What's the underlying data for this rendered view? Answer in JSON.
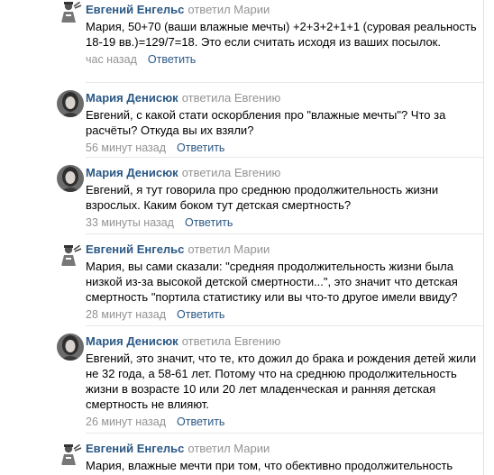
{
  "comments": [
    {
      "author": "Евгений Енгельс",
      "action": "ответил",
      "target": "Марии",
      "avatar": "doctor-icon",
      "text": "Мария, 50+70 (ваши влажные мечты) +2+3+2+1+1 (суровая реальность 18-19 вв.)=129/7=18. Это если считать исходя из ваших посылок.",
      "time": "час назад",
      "reply": "Ответить"
    },
    {
      "author": "Мария Денисюк",
      "action": "ответила",
      "target": "Евгению",
      "avatar": "user-photo-icon",
      "text": "Евгений, с какой стати оскорбления про \"влажные мечты\"? Что за расчёты? Откуда вы их взяли?",
      "time": "56 минут назад",
      "reply": "Ответить"
    },
    {
      "author": "Мария Денисюк",
      "action": "ответила",
      "target": "Евгению",
      "avatar": "user-photo-icon",
      "text": "Евгений, я тут говорила про среднюю продолжительность жизни взрослых. Каким боком тут детская смертность?",
      "time": "33 минуты назад",
      "reply": "Ответить"
    },
    {
      "author": "Евгений Енгельс",
      "action": "ответил",
      "target": "Марии",
      "avatar": "doctor-icon",
      "text": "Мария, вы сами сказали: \"средняя продолжительность жизни была низкой из-за высокой детской смертности...\", это значит что детская смертность \"портила статистику или вы что-то другое имели ввиду?",
      "time": "28 минут назад",
      "reply": "Ответить"
    },
    {
      "author": "Мария Денисюк",
      "action": "ответила",
      "target": "Евгению",
      "avatar": "user-photo-icon",
      "text": "Евгений, это значит, что те, кто дожил до брака и рождения детей жили не 32 года, а 58-61 лет. Потому что на среднюю продолжительность жизни в возрасте 10 или 20 лет младенческая и ранняя детская смертность не влияют.",
      "time": "26 минут назад",
      "reply": "Ответить"
    },
    {
      "author": "Евгений Енгельс",
      "action": "ответил",
      "target": "Марии",
      "avatar": "doctor-icon",
      "text": "Мария, влажные мечти при том, что обективно продолжительность",
      "time": "",
      "reply": ""
    }
  ],
  "colors": {
    "author": "#2a5885",
    "muted": "#939393",
    "divider": "#e7e8ec"
  }
}
